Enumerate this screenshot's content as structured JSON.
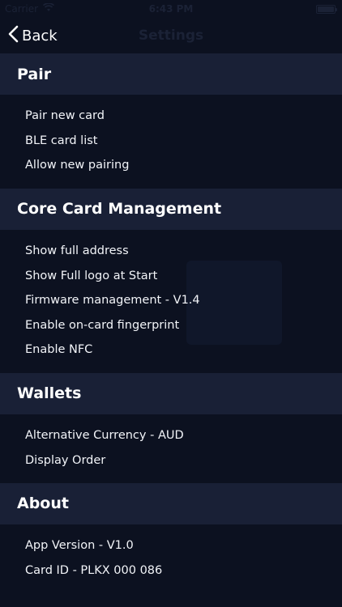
{
  "status_bar": {
    "carrier": "Carrier",
    "time": "6:43 PM"
  },
  "nav": {
    "back_label": "Back",
    "title": "Settings"
  },
  "sections": [
    {
      "title": "Pair",
      "items": [
        "Pair new card",
        "BLE card list",
        "Allow new pairing"
      ]
    },
    {
      "title": "Core Card Management",
      "items": [
        "Show full address",
        "Show Full logo at Start",
        "Firmware management - V1.4",
        "Enable on-card fingerprint",
        "Enable NFC"
      ]
    },
    {
      "title": "Wallets",
      "items": [
        "Alternative Currency - AUD",
        "Display Order"
      ]
    },
    {
      "title": "About",
      "items": [
        "App Version - V1.0",
        "Card ID - PLKX 000 086"
      ]
    }
  ],
  "colors": {
    "background": "#0c1120",
    "section_header": "#192036",
    "text": "#ffffff",
    "faded": "#1b2236"
  }
}
